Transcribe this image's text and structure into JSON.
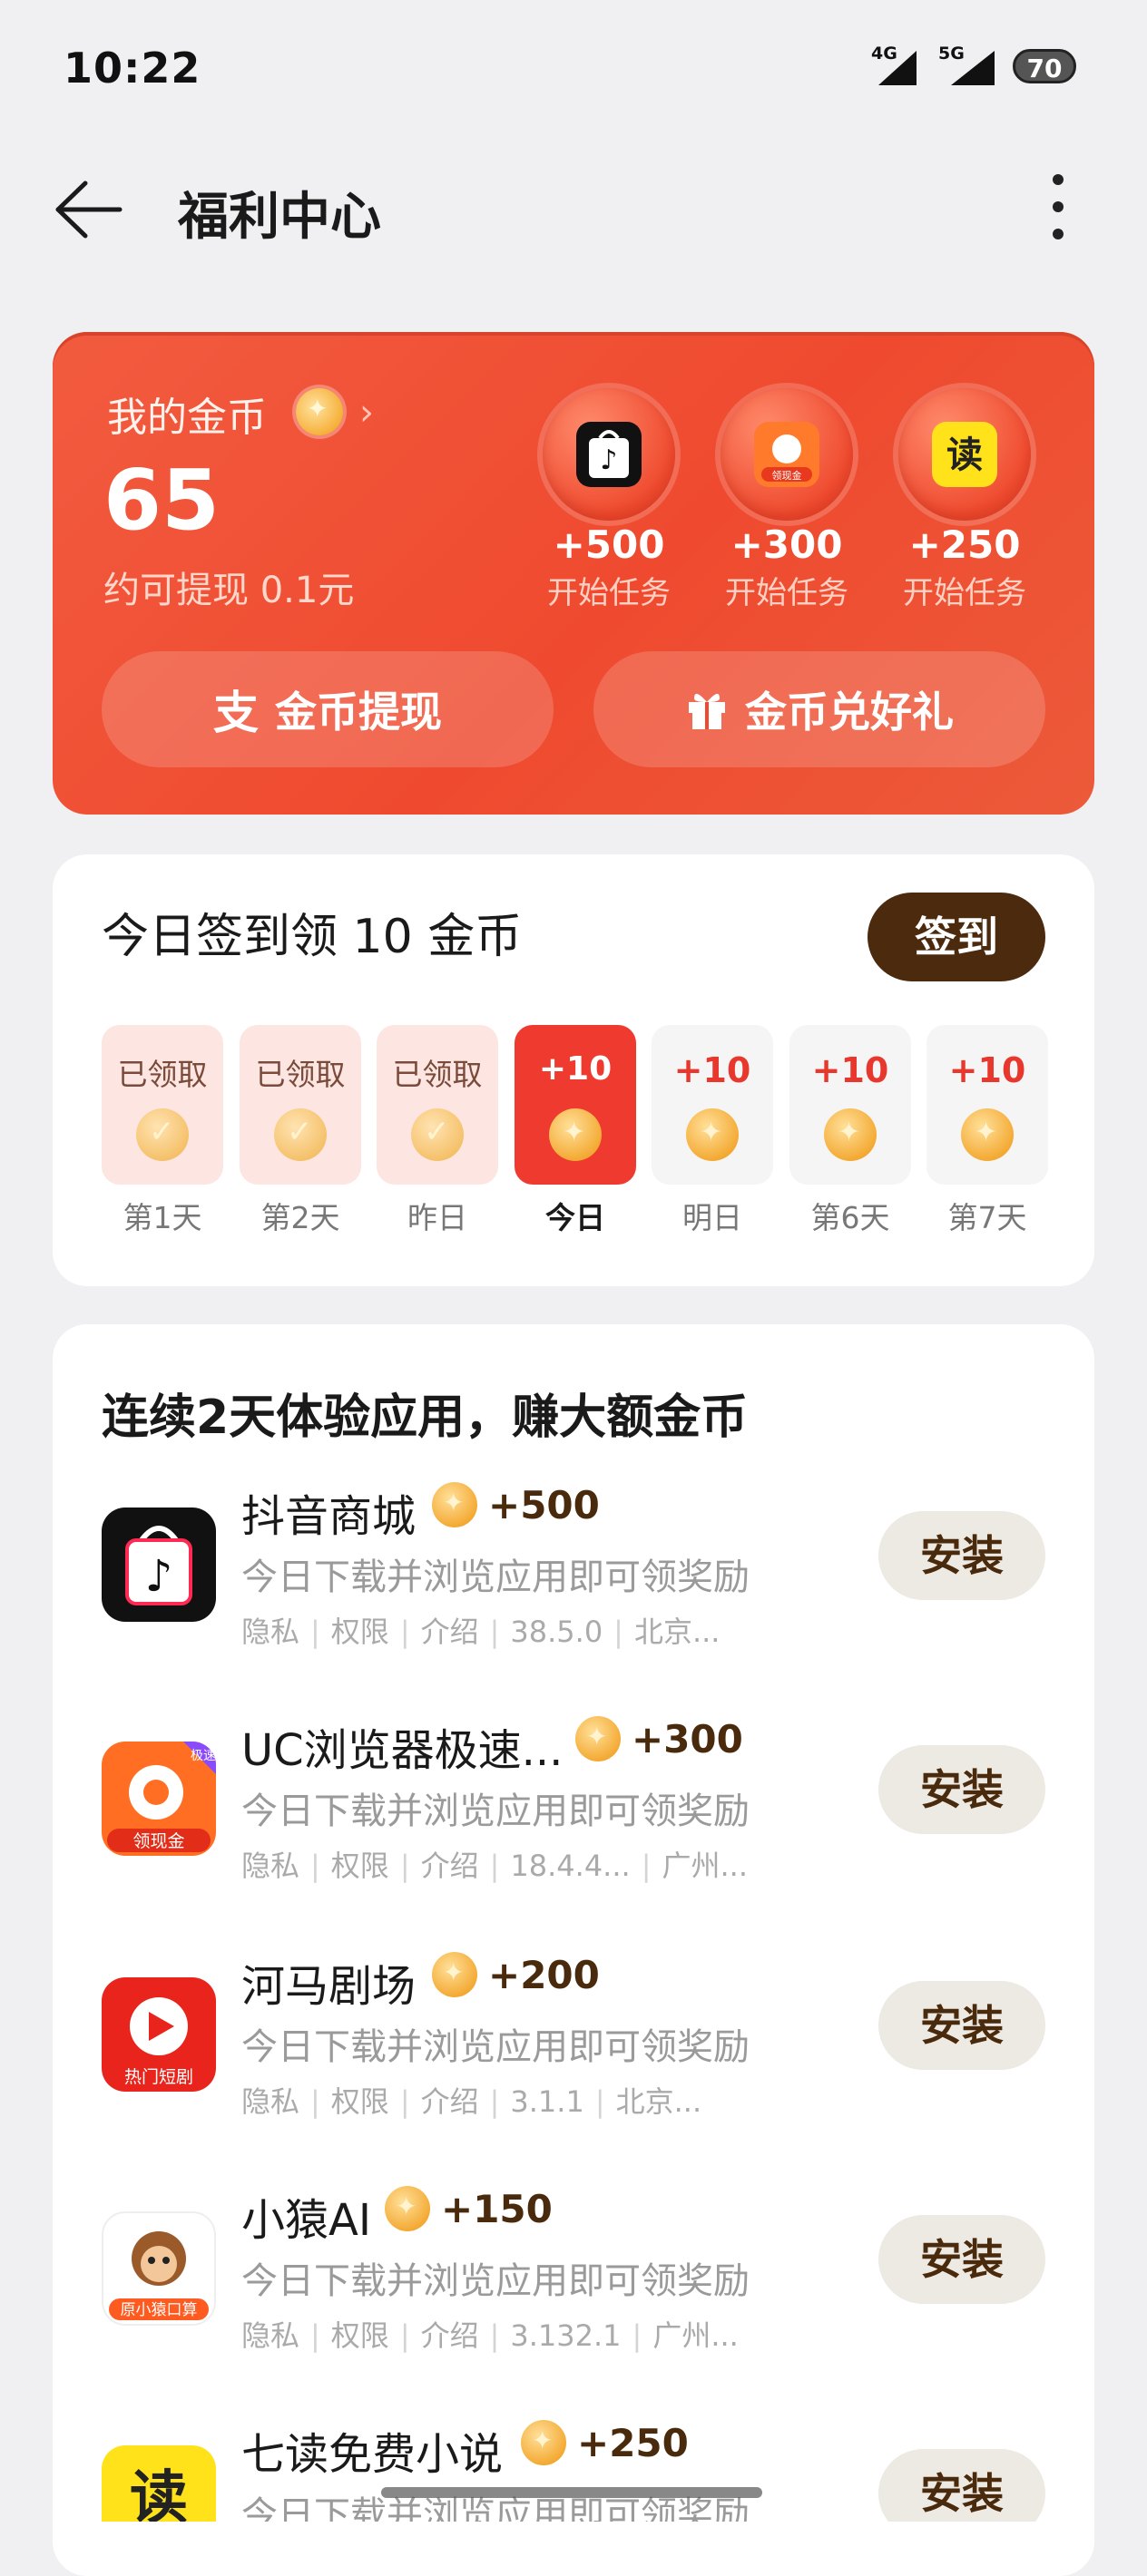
{
  "status_bar": {
    "time": "10:22",
    "signal_1": "4G",
    "signal_2": "5G",
    "battery": "70"
  },
  "header": {
    "title": "福利中心"
  },
  "coin_card": {
    "label": "我的金币",
    "balance": "65",
    "approx": "约可提现 0.1元",
    "tasks": [
      {
        "amount": "+500",
        "label": "开始任务",
        "app": "抖音商城"
      },
      {
        "amount": "+300",
        "label": "开始任务",
        "app": "UC浏览器极速版"
      },
      {
        "amount": "+250",
        "label": "开始任务",
        "app": "七读免费小说"
      }
    ],
    "withdraw_label": "金币提现",
    "gift_label": "金币兑好礼",
    "uc_icon_text": "领现金",
    "read_icon_text": "读"
  },
  "checkin": {
    "title": "今日签到领 10 金币",
    "button": "签到",
    "days": [
      {
        "top": "已领取",
        "label": "第1天",
        "state": "claimed"
      },
      {
        "top": "已领取",
        "label": "第2天",
        "state": "claimed"
      },
      {
        "top": "已领取",
        "label": "昨日",
        "state": "claimed"
      },
      {
        "top": "+10",
        "label": "今日",
        "state": "today"
      },
      {
        "top": "+10",
        "label": "明日",
        "state": "future"
      },
      {
        "top": "+10",
        "label": "第6天",
        "state": "future"
      },
      {
        "top": "+10",
        "label": "第7天",
        "state": "future"
      }
    ]
  },
  "app_list": {
    "title": "连续2天体验应用，赚大额金币",
    "install_label": "安装",
    "meta_labels": [
      "隐私",
      "权限",
      "介绍"
    ],
    "apps": [
      {
        "name": "抖音商城",
        "reward": "+500",
        "desc": "今日下载并浏览应用即可领奖励",
        "version": "38.5.0",
        "vendor": "北京..."
      },
      {
        "name": "UC浏览器极速...",
        "reward": "+300",
        "desc": "今日下载并浏览应用即可领奖励",
        "version": "18.4.4...",
        "vendor": "广州...",
        "icon_badge": "极速",
        "icon_text": "领现金"
      },
      {
        "name": "河马剧场",
        "reward": "+200",
        "desc": "今日下载并浏览应用即可领奖励",
        "version": "3.1.1",
        "vendor": "北京...",
        "icon_text": "热门短剧"
      },
      {
        "name": "小猿AI",
        "reward": "+150",
        "desc": "今日下载并浏览应用即可领奖励",
        "version": "3.132.1",
        "vendor": "广州...",
        "icon_text": "原小猿口算"
      },
      {
        "name": "七读免费小说",
        "reward": "+250",
        "desc": "今日下载并浏览应用即可领奖励",
        "icon_text": "读"
      }
    ]
  },
  "colors": {
    "accent": "#ef4a2f",
    "checkin_button": "#4b2a0e",
    "install_button": "#ede9e3",
    "background": "#f0f0f2"
  }
}
